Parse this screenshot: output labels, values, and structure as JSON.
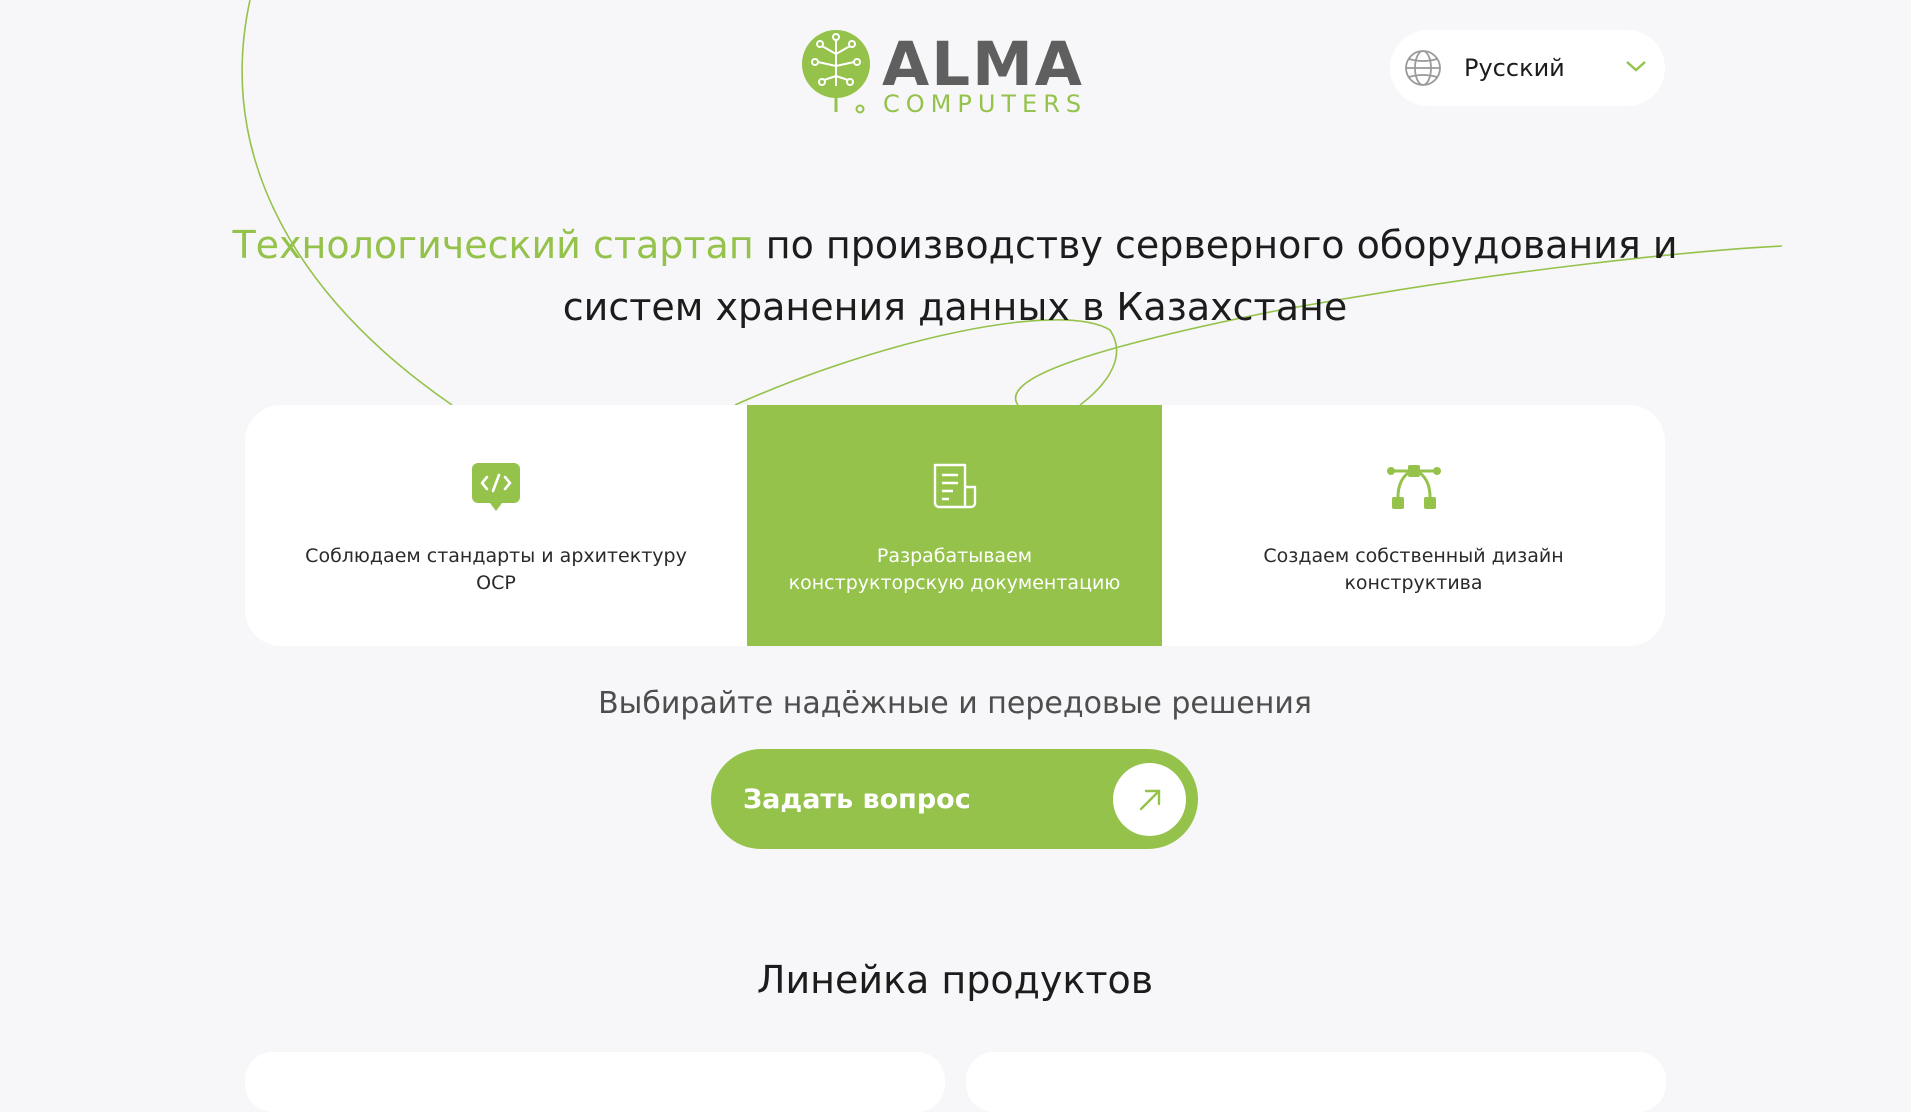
{
  "brand": {
    "name": "ALMA",
    "sub": "COMPUTERS",
    "accent_color": "#94c24a",
    "text_color": "#5f5f5f"
  },
  "language": {
    "icon": "globe-icon",
    "selected": "Русский",
    "dropdown_icon": "chevron-down-icon"
  },
  "hero": {
    "accent": "Технологический стартап",
    "rest": " по производству серверного оборудования и систем хранения данных в Казахстане"
  },
  "features": [
    {
      "icon": "code-chat-icon",
      "text": "Соблюдаем стандарты и архитектуру OCP"
    },
    {
      "icon": "document-icon",
      "text": "Разрабатываем конструкторскую документацию"
    },
    {
      "icon": "vector-path-icon",
      "text": "Создаем собственный дизайн конструктива"
    }
  ],
  "tagline": "Выбирайте надёжные и передовые решения",
  "cta": {
    "label": "Задать вопрос",
    "icon": "arrow-up-right-icon"
  },
  "products": {
    "title": "Линейка продуктов"
  }
}
